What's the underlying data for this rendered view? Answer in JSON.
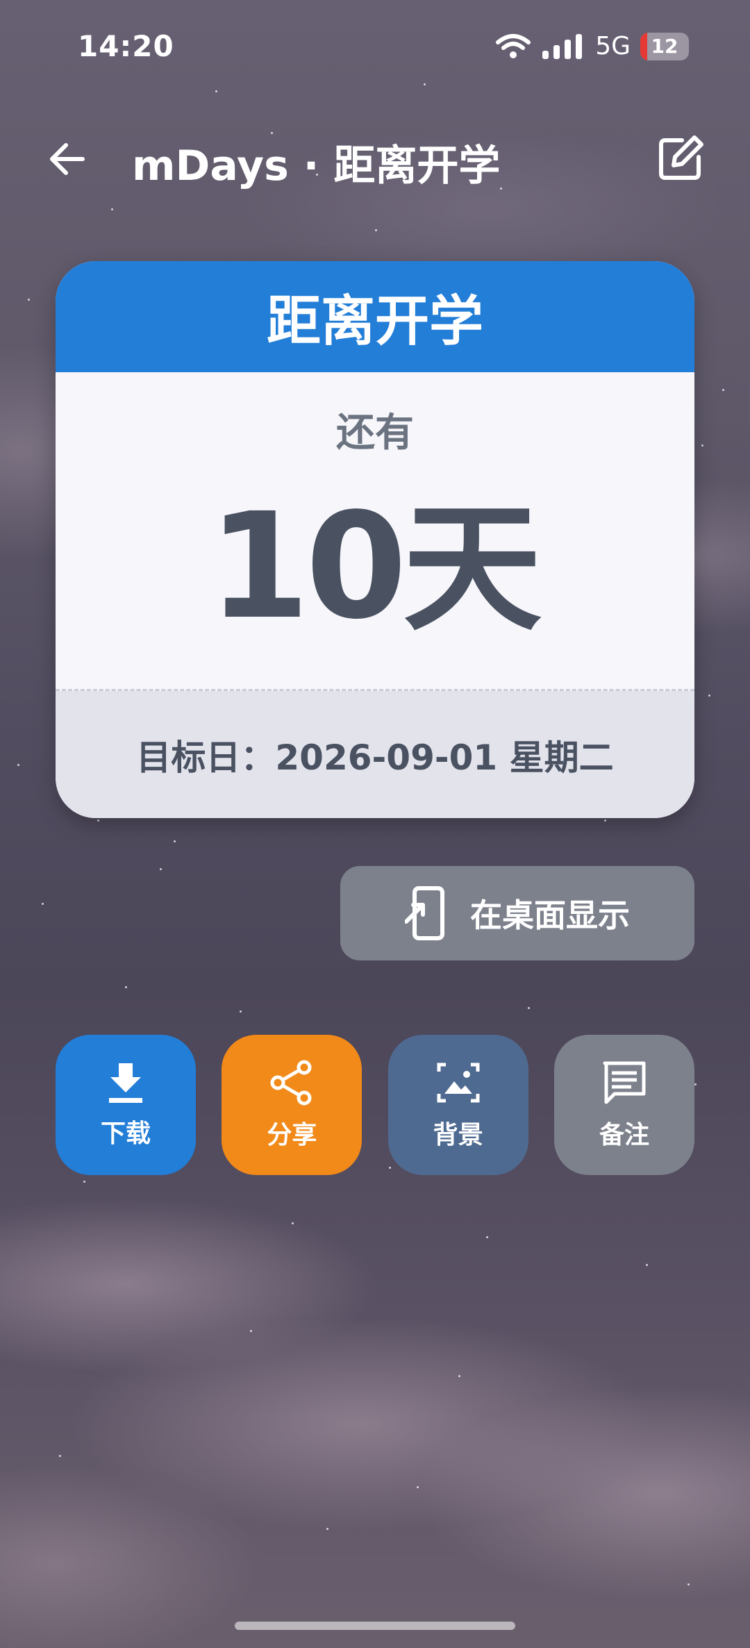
{
  "status_bar": {
    "time": "14:20",
    "network": "5G",
    "battery": "12",
    "icons": [
      "wifi-icon",
      "signal-icon",
      "battery-icon"
    ]
  },
  "top_bar": {
    "title": "mDays · 距离开学",
    "back_icon": "arrow-left-icon",
    "edit_icon": "edit-icon"
  },
  "card": {
    "header": "距离开学",
    "remaining_label": "还有",
    "days": "10",
    "unit": "天",
    "target_date": "目标日：2026-09-01 星期二",
    "accent_color": "#237ed8"
  },
  "desktop_button": {
    "label": "在桌面显示",
    "icon": "phone-arrow-icon"
  },
  "actions": [
    {
      "label": "下载",
      "icon": "download-icon",
      "color": "#237ed8"
    },
    {
      "label": "分享",
      "icon": "share-icon",
      "color": "#f28a1a"
    },
    {
      "label": "背景",
      "icon": "image-icon",
      "color": "#4f6a91"
    },
    {
      "label": "备注",
      "icon": "comment-icon",
      "color": "#7d818c"
    }
  ]
}
